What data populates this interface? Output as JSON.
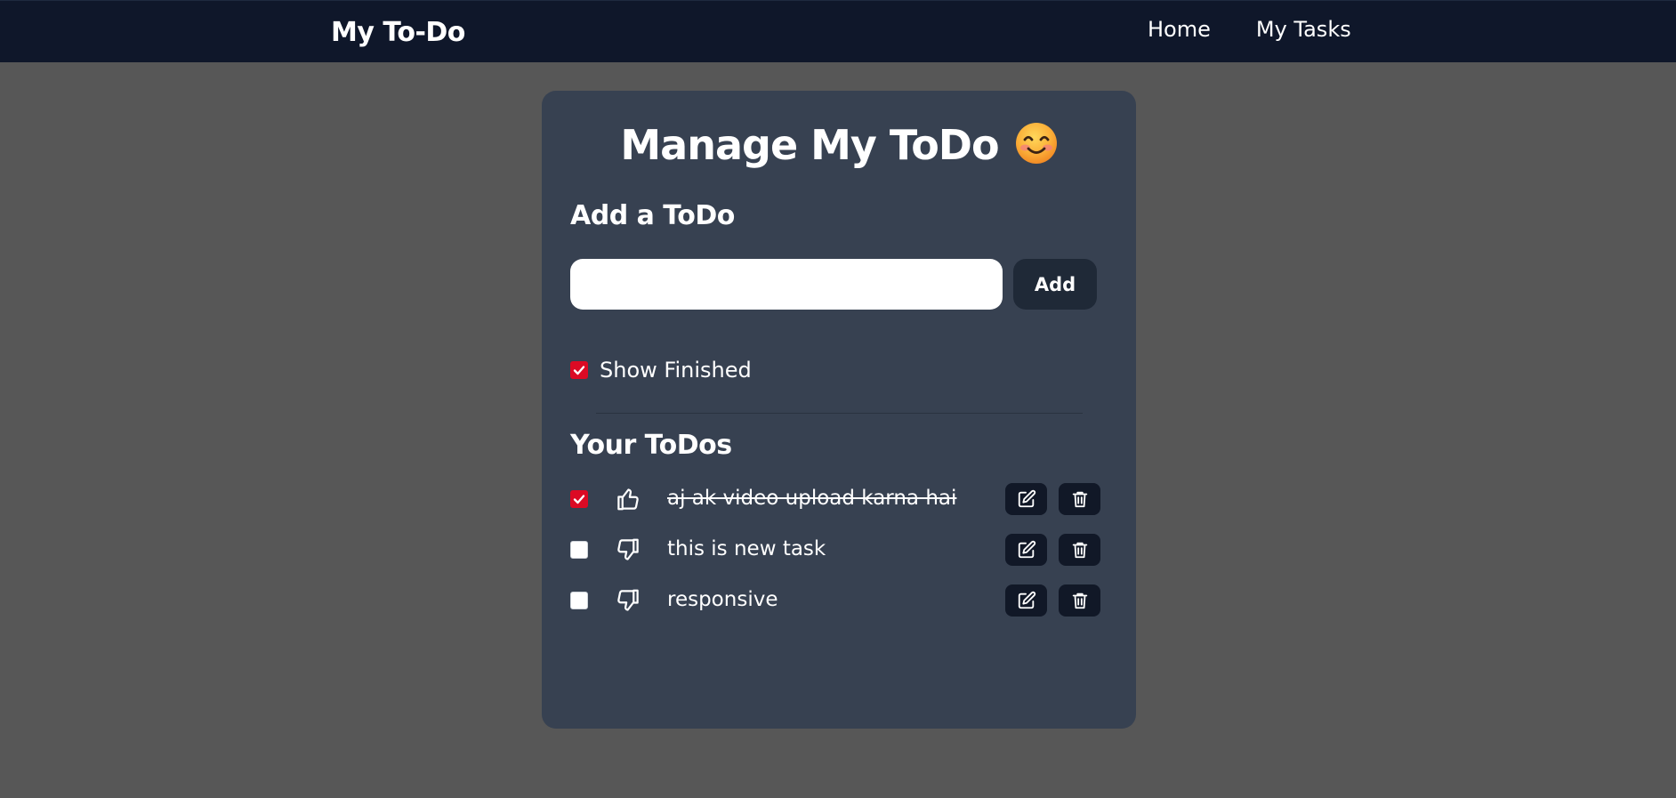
{
  "navbar": {
    "brand": "My To-Do",
    "links": [
      "Home",
      "My Tasks"
    ]
  },
  "card": {
    "title": "Manage My ToDo",
    "title_icon": "smiling-face-emoji",
    "add_section": {
      "title": "Add a ToDo",
      "input_value": "",
      "add_button_label": "Add"
    },
    "show_finished": {
      "label": "Show Finished",
      "checked": true
    },
    "list_title": "Your ToDos",
    "todos": [
      {
        "text": "aj ak video upload karna hai",
        "completed": true,
        "status_icon": "thumbs-up-icon"
      },
      {
        "text": "this is new task",
        "completed": false,
        "status_icon": "thumbs-down-icon"
      },
      {
        "text": "responsive",
        "completed": false,
        "status_icon": "thumbs-down-icon"
      }
    ]
  },
  "colors": {
    "page_background": "#575757",
    "navbar_background": "#0f172a",
    "card_background": "#374151",
    "button_dark": "#1f2937",
    "icon_button_background": "#111827",
    "checkbox_checked": "#dc0a24",
    "text": "#ffffff"
  }
}
